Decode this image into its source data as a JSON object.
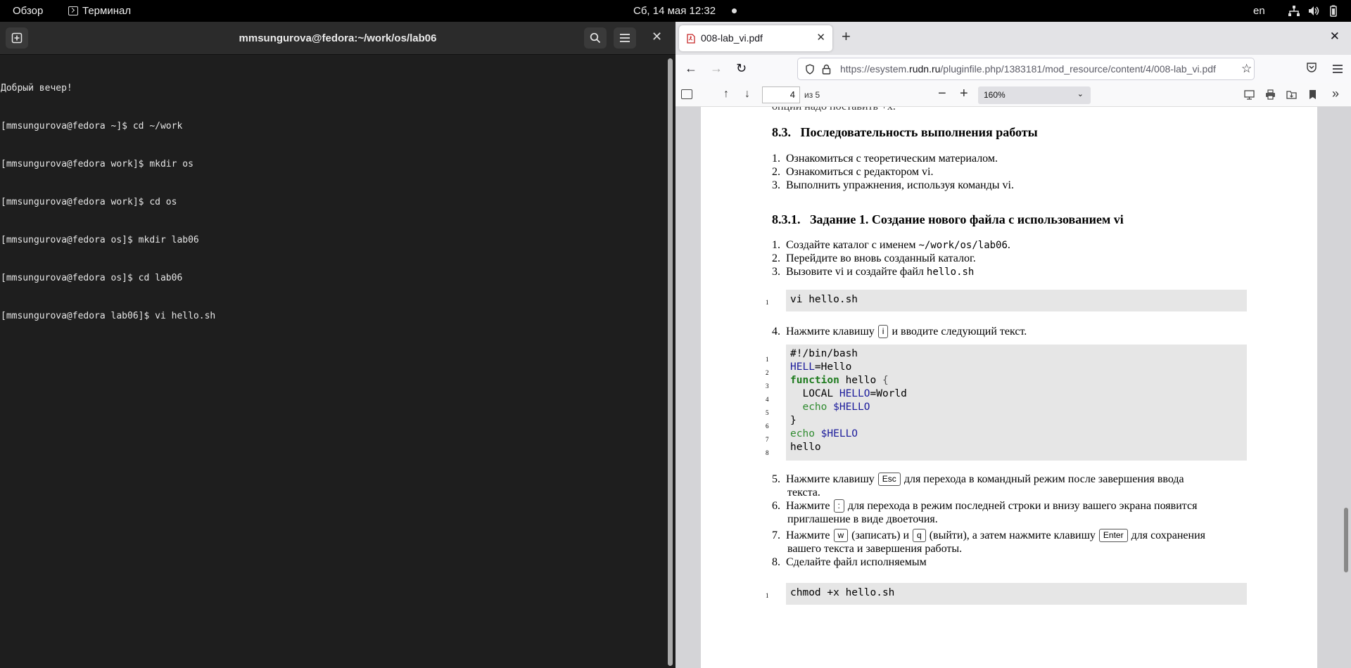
{
  "topbar": {
    "overview": "Обзор",
    "active_app": "Терминал",
    "clock": "Сб, 14 мая  12:32",
    "lang": "en"
  },
  "terminal": {
    "title": "mmsungurova@fedora:~/work/os/lab06",
    "lines": [
      "Добрый вечер!",
      "[mmsungurova@fedora ~]$ cd ~/work",
      "[mmsungurova@fedora work]$ mkdir os",
      "[mmsungurova@fedora work]$ cd os",
      "[mmsungurova@fedora os]$ mkdir lab06",
      "[mmsungurova@fedora os]$ cd lab06",
      "[mmsungurova@fedora lab06]$ vi hello.sh"
    ]
  },
  "browser": {
    "tab_title": "008-lab_vi.pdf",
    "url_prefix": "https://esystem.",
    "url_domain": "rudn.ru",
    "url_rest": "/pluginfile.php/1383181/mod_resource/content/4/008-lab_vi.pdf",
    "pdf": {
      "page_value": "4",
      "page_of": "из 5",
      "zoom": "160%"
    }
  },
  "doc": {
    "cut_line": "опции надо поставить +x.",
    "section_num": "8.3.",
    "section_title": "Последовательность выполнения работы",
    "steps": [
      "Ознакомиться с теоретическим материалом.",
      "Ознакомиться с редактором vi.",
      "Выполнить упражнения, используя команды vi."
    ],
    "subsection_num": "8.3.1.",
    "subsection_title": "Задание 1. Создание нового файла с использованием vi",
    "task1_pre": "Создайте каталог с именем",
    "task1_path": "~/work/os/lab06",
    "task1_post": ".",
    "task2": "Перейдите во вновь созданный каталог.",
    "task3_pre": "Вызовите vi и создайте файл",
    "task3_file": "hello.sh",
    "code1": "vi hello.sh",
    "task4_pre": "Нажмите клавишу",
    "task4_key": "i",
    "task4_post": "и вводите следующий текст.",
    "script": {
      "l1": "#!/bin/bash",
      "l2_var": "HELL",
      "l2_rest": "=Hello",
      "l3_kw": "function",
      "l3_rest": " hello ",
      "l3_brace": "{",
      "l4_a": "  LOCAL ",
      "l4_var": "HELLO",
      "l4_rest": "=World",
      "l5_echo": "  echo ",
      "l5_var": "$HELLO",
      "l6": "}",
      "l7_echo": "echo ",
      "l7_var": "$HELLO",
      "l8": "hello"
    },
    "task5_pre": "Нажмите клавишу",
    "task5_key": "Esc",
    "task5_post": "для перехода в командный режим после завершения ввода",
    "task5_cont": "текста.",
    "task6_pre": "Нажмите",
    "task6_key": ":",
    "task6_post": "для перехода в режим последней строки и внизу вашего экрана появится",
    "task6_cont": "приглашение в виде двоеточия.",
    "task7_pre": "Нажмите",
    "task7_key1": "w",
    "task7_mid1": "(записать) и",
    "task7_key2": "q",
    "task7_mid2": "(выйти), а затем нажмите клавишу",
    "task7_key3": "Enter",
    "task7_post": "для сохранения",
    "task7_cont": "вашего текста и завершения работы.",
    "task8": "Сделайте файл исполняемым",
    "code2": "chmod +x hello.sh"
  },
  "colors": {
    "terminal_bg": "#1e1e1e",
    "code_bg": "#e6e6e6"
  }
}
